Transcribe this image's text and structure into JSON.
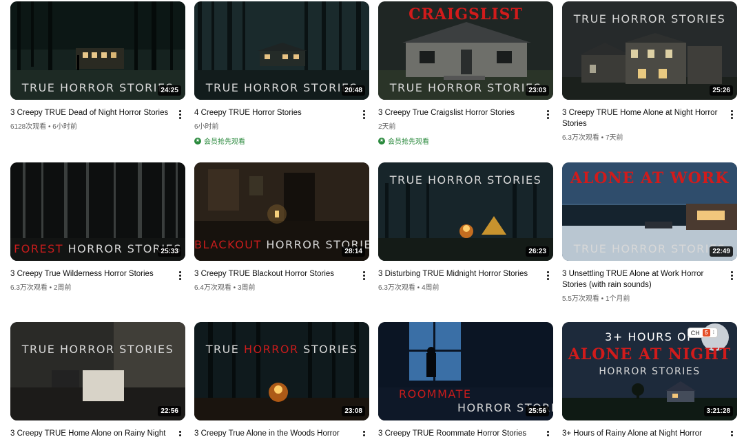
{
  "videos": [
    {
      "title": "3 Creepy TRUE Dead of Night Horror Stories",
      "meta": "6128次观看 • 6小时前",
      "duration": "24:25",
      "thumb_text": "TRUE HORROR STORIES"
    },
    {
      "title": "4 Creepy TRUE Horror Stories",
      "meta": "6小时前",
      "badge": "会员抢先观看",
      "duration": "20:48",
      "thumb_text": "TRUE HORROR STORIES"
    },
    {
      "title": "3 Creepy True Craigslist Horror Stories",
      "meta": "2天前",
      "badge": "会员抢先观看",
      "duration": "23:03",
      "thumb_top_text": "CRAIGSLIST",
      "thumb_text": "TRUE HORROR STORIES"
    },
    {
      "title": "3 Creepy TRUE Home Alone at Night Horror Stories",
      "meta": "6.3万次观看 • 7天前",
      "duration": "25:26",
      "thumb_top_text": "TRUE HORROR STORIES"
    },
    {
      "title": "3 Creepy True Wilderness Horror Stories",
      "meta": "6.3万次观看 • 2周前",
      "duration": "25:33",
      "thumb_text_red": "FOREST",
      "thumb_text": "HORROR STORIES"
    },
    {
      "title": "3 Creepy TRUE Blackout Horror Stories",
      "meta": "6.4万次观看 • 3周前",
      "duration": "28:14",
      "thumb_text_red": "BLACKOUT",
      "thumb_text": "HORROR STORIES"
    },
    {
      "title": "3 Disturbing TRUE Midnight Horror Stories",
      "meta": "6.3万次观看 • 4周前",
      "duration": "26:23",
      "thumb_top_text": "TRUE HORROR STORIES"
    },
    {
      "title": "3 Unsettling TRUE Alone at Work Horror Stories (with rain sounds)",
      "meta": "5.5万次观看 • 1个月前",
      "duration": "22:49",
      "thumb_top_text": "ALONE AT WORK",
      "thumb_text": "TRUE HORROR STORIES"
    },
    {
      "title": "3 Creepy TRUE Home Alone on Rainy Night",
      "duration": "22:56",
      "thumb_top_text": "TRUE HORROR STORIES"
    },
    {
      "title": "3 Creepy True Alone in the Woods Horror",
      "duration": "23:08",
      "thumb_top_a": "TRUE",
      "thumb_top_red": "HORROR",
      "thumb_top_b": "STORIES"
    },
    {
      "title": "3 Creepy TRUE Roommate Horror Stories",
      "duration": "25:56",
      "thumb_text_red": "ROOMMATE",
      "thumb_text": "HORROR STORIES"
    },
    {
      "title": "3+ Hours of Rainy Alone at Night Horror",
      "duration": "3:21:28",
      "thumb_line1": "3+ HOURS OF",
      "thumb_line2": "ALONE AT NIGHT",
      "thumb_line3": "HORROR STORIES",
      "widget_label": "CH",
      "widget_icon": "html5-icon"
    }
  ]
}
